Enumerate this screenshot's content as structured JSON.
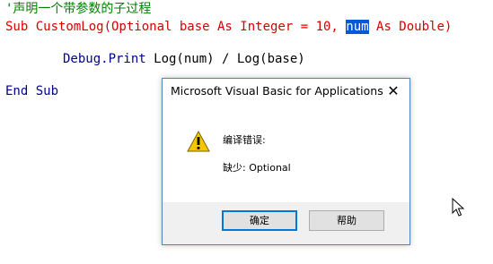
{
  "editor": {
    "comment_line": "'声明一个带参数的子过程",
    "sub_line_before": "Sub CustomLog(Optional base As Integer = 10, ",
    "sub_line_selected": "num",
    "sub_line_after": " As Double)",
    "debug_keyword": "Debug.Print",
    "debug_expr": " Log(num) / Log(base)",
    "end_sub": "End Sub"
  },
  "dialog": {
    "title": "Microsoft Visual Basic for Applications",
    "close_symbol": "✕",
    "message_title": "编译错误:",
    "message_detail": "缺少: Optional",
    "ok_label": "确定",
    "help_label": "帮助",
    "icon": "warning-icon"
  },
  "colors": {
    "comment": "#008000",
    "error_line": "#d40000",
    "keyword": "#00008b",
    "selection": "#0a57d6"
  }
}
